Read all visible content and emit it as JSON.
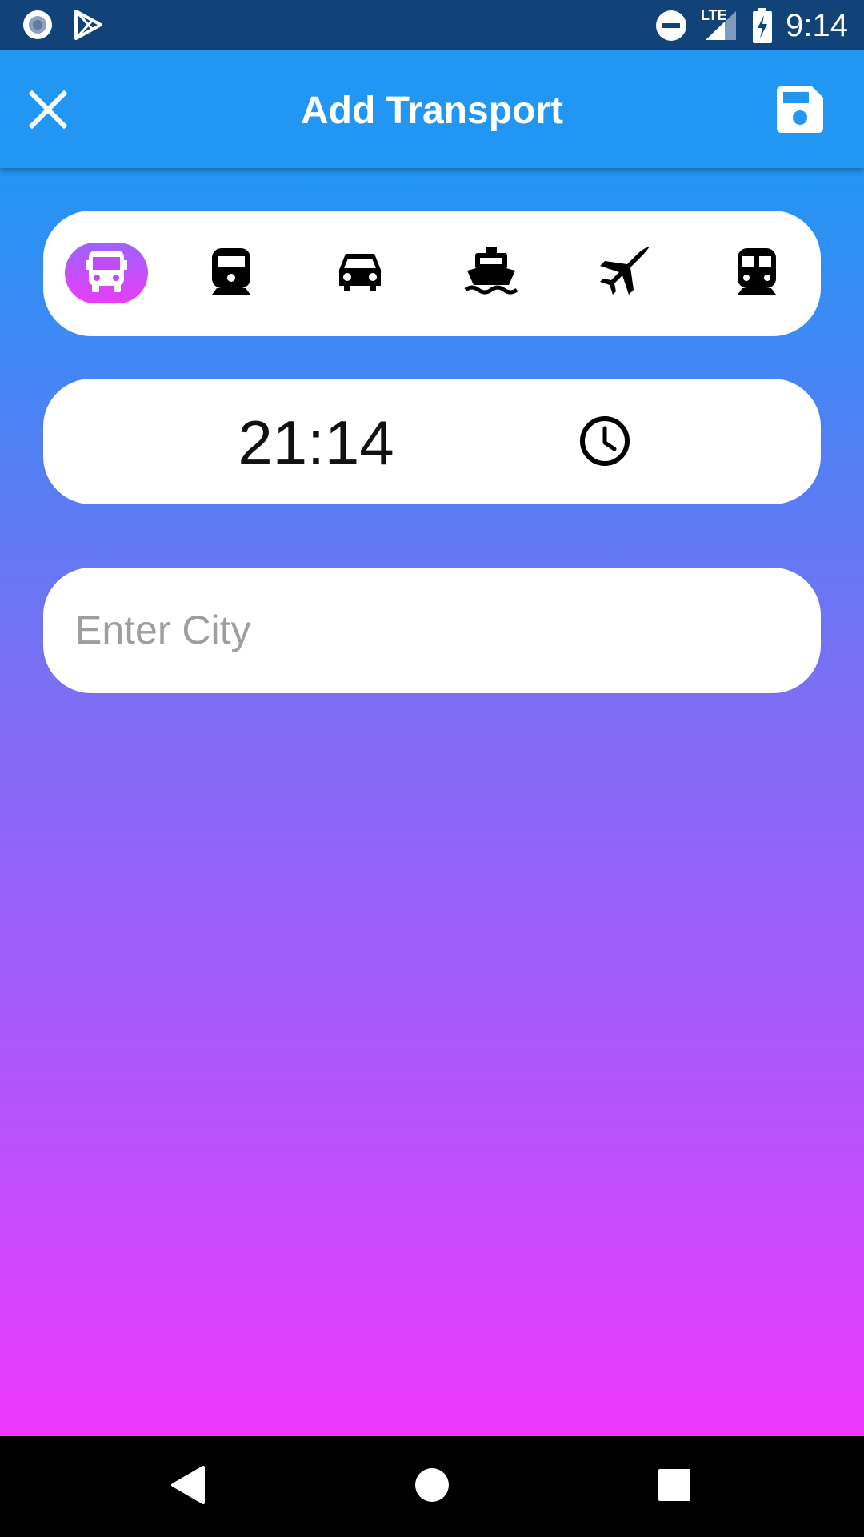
{
  "status_bar": {
    "time": "9:14",
    "network": "LTE",
    "icons": [
      "record-icon",
      "play-store-icon",
      "do-not-disturb-icon",
      "signal-icon",
      "battery-charging-icon"
    ]
  },
  "app_bar": {
    "title": "Add Transport",
    "close_icon": "close-icon",
    "save_icon": "save-icon",
    "background": "#2196f3"
  },
  "transport_selector": {
    "options": [
      {
        "name": "bus",
        "icon": "bus-icon",
        "selected": true
      },
      {
        "name": "train",
        "icon": "train-icon",
        "selected": false
      },
      {
        "name": "car",
        "icon": "car-icon",
        "selected": false
      },
      {
        "name": "ferry",
        "icon": "ferry-icon",
        "selected": false
      },
      {
        "name": "flight",
        "icon": "airplane-icon",
        "selected": false
      },
      {
        "name": "subway",
        "icon": "subway-icon",
        "selected": false
      }
    ],
    "selected_color": "#c04cf9"
  },
  "time_picker": {
    "value": "21:14",
    "icon": "clock-icon"
  },
  "city_field": {
    "value": "",
    "placeholder": "Enter City"
  },
  "nav_bar": {
    "icons": [
      "back-icon",
      "home-icon",
      "recents-icon"
    ]
  },
  "colors": {
    "gradient_top": "#2196f3",
    "gradient_bottom": "#ee37ff",
    "status_bar": "#114378"
  }
}
